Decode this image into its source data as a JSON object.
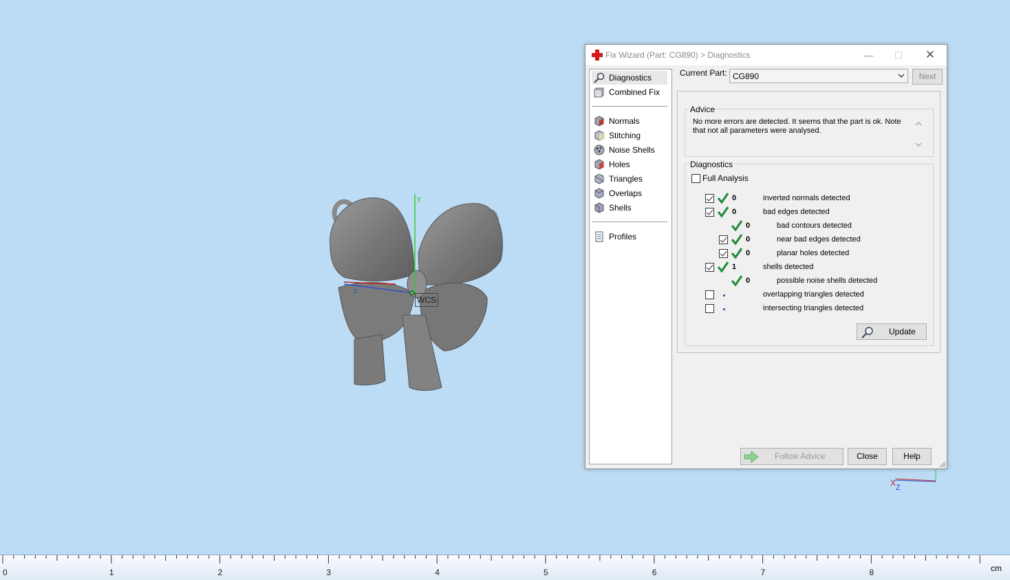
{
  "viewport": {
    "wcs_label": "WCS",
    "axis_y_label": "y",
    "axis_z_label": "z",
    "mini_axis_x_label": "X",
    "mini_axis_z_label": "Z"
  },
  "ruler": {
    "unit": "cm",
    "labels": [
      "0",
      "1",
      "2",
      "3",
      "4",
      "5",
      "6",
      "7",
      "8"
    ]
  },
  "dialog": {
    "title": "Fix Wizard (Part: CG890) > Diagnostics",
    "nav": {
      "top": [
        {
          "label": "Diagnostics",
          "icon": "magnifier-icon",
          "selected": true
        },
        {
          "label": "Combined Fix",
          "icon": "combined-fix-icon",
          "selected": false
        }
      ],
      "middle": [
        {
          "label": "Normals",
          "icon": "normals-icon"
        },
        {
          "label": "Stitching",
          "icon": "stitching-icon"
        },
        {
          "label": "Noise Shells",
          "icon": "noise-shells-icon"
        },
        {
          "label": "Holes",
          "icon": "holes-icon"
        },
        {
          "label": "Triangles",
          "icon": "triangles-icon"
        },
        {
          "label": "Overlaps",
          "icon": "overlaps-icon"
        },
        {
          "label": "Shells",
          "icon": "shells-icon"
        }
      ],
      "bottom": [
        {
          "label": "Profiles",
          "icon": "profiles-icon"
        }
      ]
    },
    "current_part_label": "Current Part:",
    "current_part_value": "CG890",
    "next_label": "Next",
    "advice_title": "Advice",
    "advice_text": "No more errors are detected. It seems that the part is ok. Note that not all parameters were analysed.",
    "diagnostics_title": "Diagnostics",
    "full_analysis_label": "Full Analysis",
    "full_analysis_checked": false,
    "rows": [
      {
        "label": "inverted normals detected",
        "count": "0",
        "checkbox": true,
        "checked": true,
        "indent": 0,
        "status": "ok"
      },
      {
        "label": "bad edges detected",
        "count": "0",
        "checkbox": true,
        "checked": true,
        "indent": 0,
        "status": "ok"
      },
      {
        "label": "bad contours detected",
        "count": "0",
        "checkbox": false,
        "checked": false,
        "indent": 1,
        "status": "ok"
      },
      {
        "label": "near bad edges detected",
        "count": "0",
        "checkbox": true,
        "checked": true,
        "indent": 1,
        "status": "ok"
      },
      {
        "label": "planar holes detected",
        "count": "0",
        "checkbox": true,
        "checked": true,
        "indent": 1,
        "status": "ok"
      },
      {
        "label": "shells detected",
        "count": "1",
        "checkbox": true,
        "checked": true,
        "indent": 0,
        "status": "ok"
      },
      {
        "label": "possible noise shells detected",
        "count": "0",
        "checkbox": false,
        "checked": false,
        "indent": 1,
        "status": "ok"
      },
      {
        "label": "overlapping triangles detected",
        "count": "",
        "checkbox": true,
        "checked": false,
        "indent": 0,
        "status": "pending"
      },
      {
        "label": "intersecting triangles detected",
        "count": "",
        "checkbox": true,
        "checked": false,
        "indent": 0,
        "status": "pending"
      }
    ],
    "update_label": "Update",
    "follow_advice_label": "Follow Advice",
    "close_label": "Close",
    "help_label": "Help"
  },
  "colors": {
    "background": "#bcdcf5",
    "check_green": "#1e8a3c",
    "title_icon_red": "#d21a1a",
    "axis_y": "#33cc33",
    "axis_z_blue": "#3050d0",
    "axis_x_red": "#c02020"
  }
}
